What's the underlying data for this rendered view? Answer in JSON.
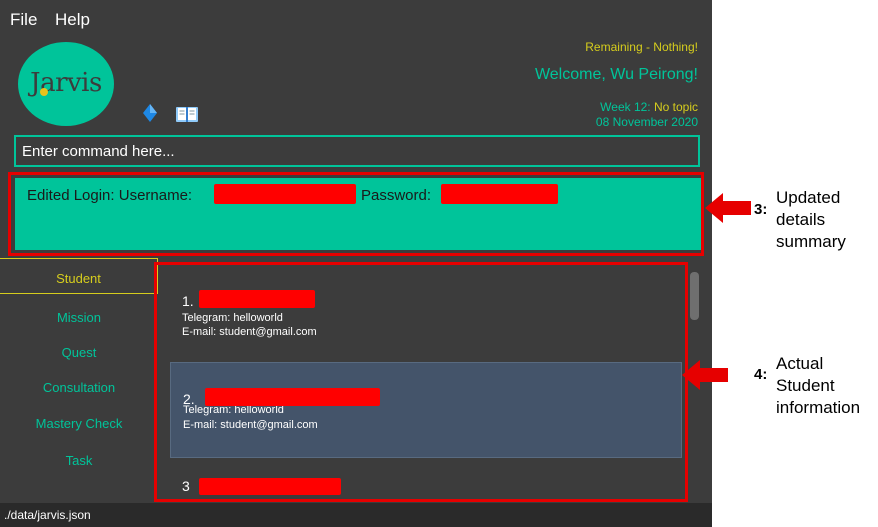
{
  "menu": {
    "file": "File",
    "help": "Help"
  },
  "logo": {
    "text": "Jarvis"
  },
  "icons": {
    "gem": "gem-icon",
    "book": "book-icon"
  },
  "header": {
    "remaining": "Remaining - Nothing!",
    "welcome": "Welcome, Wu Peirong!",
    "week_prefix": "Week 12: ",
    "week_topic": "No topic",
    "date": "08 November 2020"
  },
  "command": {
    "placeholder": "Enter command here..."
  },
  "result": {
    "prefix": "Edited Login:  Username:",
    "password_label": "Password:"
  },
  "tabs": [
    "Student",
    "Mission",
    "Quest",
    "Consultation",
    "Mastery Check",
    "Task"
  ],
  "students": [
    {
      "index": "1.",
      "telegram": "Telegram: helloworld",
      "email": "E-mail: student@gmail.com"
    },
    {
      "index": "2.",
      "telegram": "Telegram: helloworld",
      "email": "E-mail: student@gmail.com"
    },
    {
      "index": "3"
    }
  ],
  "status": {
    "path": "./data/jarvis.json"
  },
  "annotations": {
    "a3_num": "3:",
    "a3_text": [
      "Updated",
      "details",
      "summary"
    ],
    "a4_num": "4:",
    "a4_text": [
      "Actual",
      "Student",
      "information"
    ]
  },
  "colors": {
    "background": "#3c3c3c",
    "accent": "#00c49a",
    "highlight": "#d6cd1d",
    "selected_card": "#44546a",
    "annotation_red": "#e60000"
  }
}
